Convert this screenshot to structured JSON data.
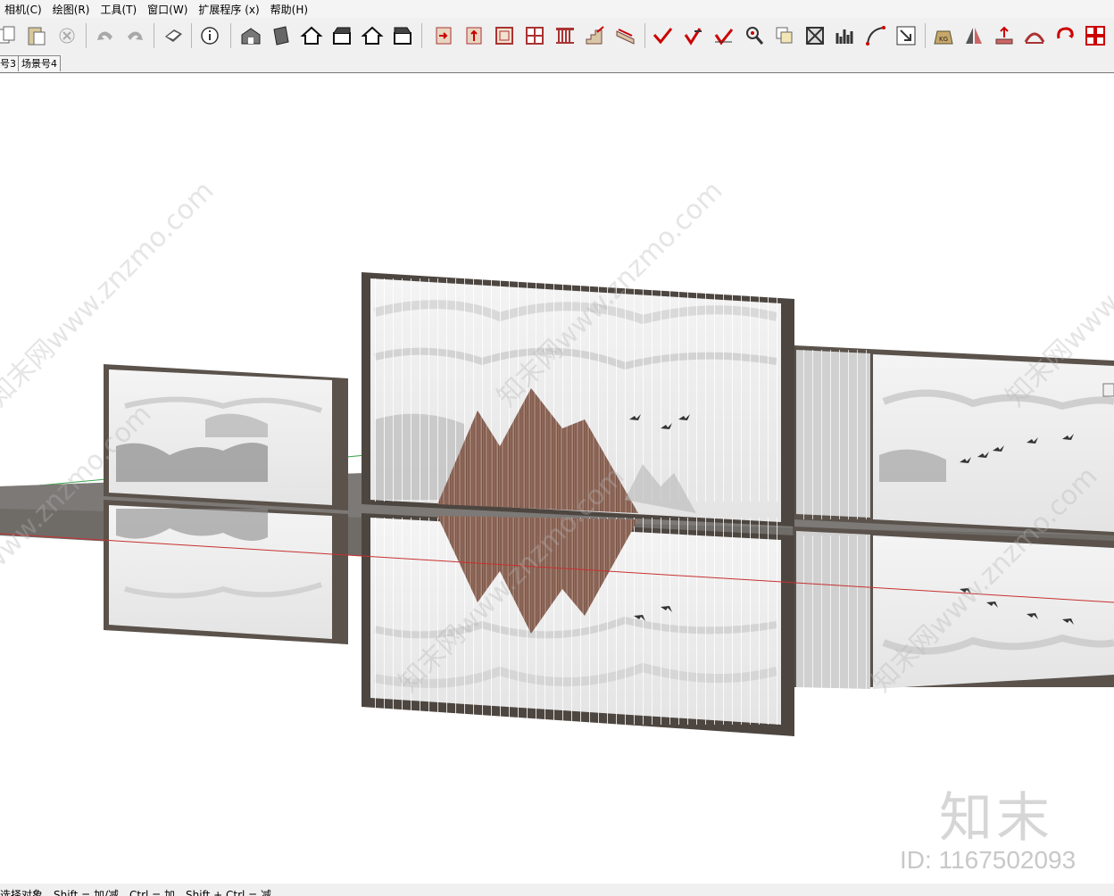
{
  "menu": {
    "items": [
      "相机(C)",
      "绘图(R)",
      "工具(T)",
      "窗口(W)",
      "扩展程序 (x)",
      "帮助(H)"
    ]
  },
  "toolbar": {
    "groups": [
      [
        "copy-icon",
        "paste-icon",
        "erase-icon"
      ],
      [
        "undo-icon",
        "redo-icon"
      ],
      [
        "print-icon"
      ],
      [
        "model-info-icon"
      ],
      [
        "view-iso-icon",
        "view-top-icon",
        "view-front-icon",
        "view-right-icon",
        "view-back-icon",
        "view-left-icon"
      ],
      [
        "door-icon",
        "window-icon",
        "frame-icon",
        "grid-icon",
        "railing-icon",
        "stairs-icon",
        "steps-icon"
      ],
      [
        "check-icon",
        "pick-icon",
        "validate-icon",
        "find-icon",
        "layer-icon",
        "box-icon",
        "bars-icon",
        "arc-icon",
        "arrow-icon"
      ],
      [
        "weight-icon",
        "mirror-icon",
        "upload-icon",
        "arch-icon",
        "rotate-icon",
        "component-icon"
      ]
    ]
  },
  "tabs": [
    "号3",
    "场景号4"
  ],
  "status": {
    "text": "选择对象。Shift = 加/减，Ctrl = 加，Shift + Ctrl = 减"
  },
  "watermark": {
    "site": "知末网www.znzmo.com",
    "logo": "知末",
    "id": "ID: 1167502093"
  },
  "colors": {
    "frame": "#4d4640",
    "floor": "#6f6c68",
    "mountain": "#8f6a5b",
    "redline": "#c83030"
  }
}
